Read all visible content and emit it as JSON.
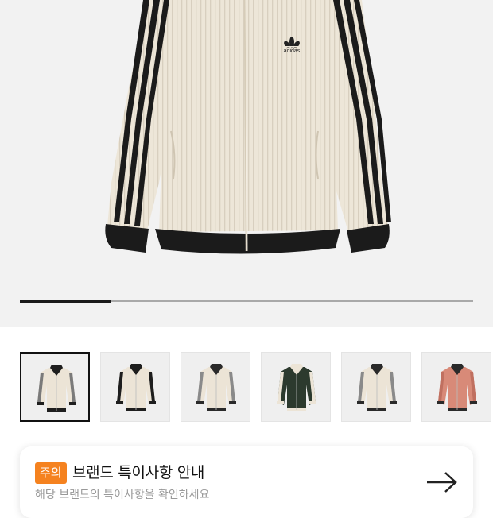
{
  "product": {
    "brand_logo_text": "adidas",
    "gallery_progress": 0.2
  },
  "thumbnails": [
    {
      "name": "thumb-1",
      "body": "#ece4d6",
      "stripe": "#7a7a7a",
      "collar": "#1e1e1e",
      "selected": true
    },
    {
      "name": "thumb-2",
      "body": "#ece4d6",
      "stripe": "#1e1e1e",
      "collar": "#1e1e1e",
      "selected": false
    },
    {
      "name": "thumb-3",
      "body": "#ece4d6",
      "stripe": "#8a8a8a",
      "collar": "#2a2a2a",
      "selected": false
    },
    {
      "name": "thumb-4",
      "body": "#2c3a2e",
      "stripe": "#ece4d6",
      "collar": "#ece4d6",
      "selected": false
    },
    {
      "name": "thumb-5",
      "body": "#ece4d6",
      "stripe": "#8a8a8a",
      "collar": "#2a2a2a",
      "selected": false
    },
    {
      "name": "thumb-6",
      "body": "#d88a78",
      "stripe": "#c07060",
      "collar": "#2a2a2a",
      "selected": false
    }
  ],
  "notice": {
    "badge": "주의",
    "title": "브랜드 특이사항 안내",
    "subtitle": "해당 브랜드의 특이사항을 확인하세요"
  },
  "colors": {
    "badge": "#f5821f",
    "hero_bg": "#f2f2f2",
    "jacket_body": "#ede6d8",
    "jacket_trim": "#1b1b1b"
  }
}
